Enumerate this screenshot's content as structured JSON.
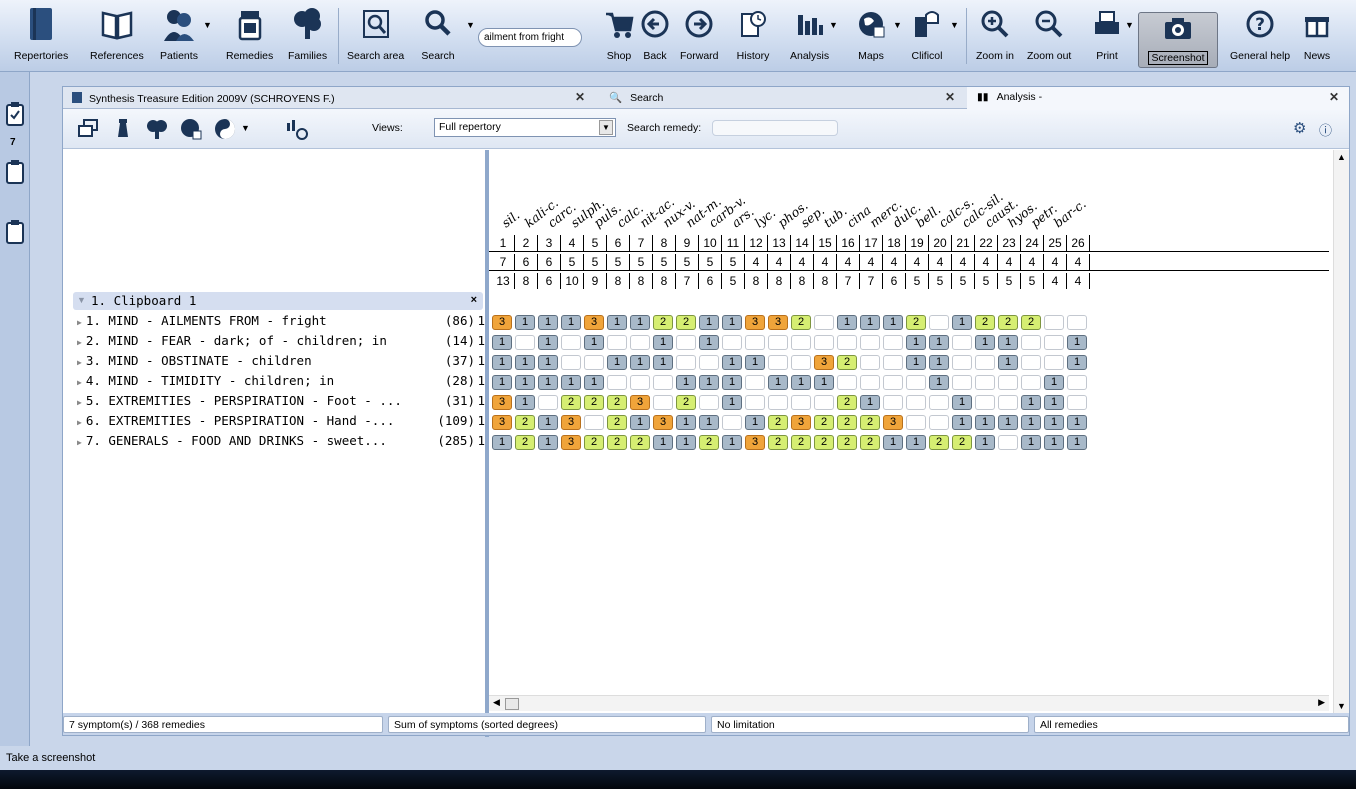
{
  "toolbar": {
    "repertories": "Repertories",
    "references": "References",
    "patients": "Patients",
    "remedies": "Remedies",
    "families": "Families",
    "search_area": "Search area",
    "search": "Search",
    "search_field": "ailment from fright",
    "shop": "Shop",
    "back": "Back",
    "forward": "Forward",
    "history": "History",
    "analysis": "Analysis",
    "maps": "Maps",
    "clificol": "Clificol",
    "zoom_in": "Zoom in",
    "zoom_out": "Zoom out",
    "print": "Print",
    "screenshot": "Screenshot",
    "general_help": "General help",
    "news": "News"
  },
  "left_strip": {
    "clipboard_count": "7"
  },
  "tabs": [
    {
      "label": "Synthesis Treasure Edition 2009V (SCHROYENS F.)"
    },
    {
      "label": "Search"
    },
    {
      "label": "Analysis -"
    }
  ],
  "subbar": {
    "views_label": "Views:",
    "views_value": "Full repertory",
    "search_remedy_label": "Search remedy:"
  },
  "clipboard": {
    "title": "1. Clipboard 1",
    "close": "×"
  },
  "symptoms": [
    {
      "label": "1. MIND - AILMENTS FROM - fright",
      "count": "(86)",
      "weight": "1"
    },
    {
      "label": "2. MIND - FEAR - dark; of - children; in",
      "count": "(14)",
      "weight": "1"
    },
    {
      "label": "3. MIND - OBSTINATE - children",
      "count": "(37)",
      "weight": "1"
    },
    {
      "label": "4. MIND - TIMIDITY - children; in",
      "count": "(28)",
      "weight": "1"
    },
    {
      "label": "5. EXTREMITIES - PERSPIRATION - Foot - ...",
      "count": "(31)",
      "weight": "1"
    },
    {
      "label": "6. EXTREMITIES - PERSPIRATION - Hand -...",
      "count": "(109)",
      "weight": "1"
    },
    {
      "label": "7. GENERALS - FOOD AND DRINKS - sweet...",
      "count": "(285)",
      "weight": "1"
    }
  ],
  "remedies": [
    "sil.",
    "kali-c.",
    "carc.",
    "sulph.",
    "puls.",
    "calc.",
    "nit-ac.",
    "nux-v.",
    "nat-m.",
    "carb-v.",
    "ars.",
    "lyc.",
    "phos.",
    "sep.",
    "tub.",
    "cina",
    "merc.",
    "dulc.",
    "bell.",
    "calc-s.",
    "calc-sil.",
    "caust.",
    "hyos.",
    "petr.",
    "bar-c."
  ],
  "rank": [
    "1",
    "2",
    "3",
    "4",
    "5",
    "6",
    "7",
    "8",
    "9",
    "10",
    "11",
    "12",
    "13",
    "14",
    "15",
    "16",
    "17",
    "18",
    "19",
    "20",
    "21",
    "22",
    "23",
    "24",
    "25",
    "26"
  ],
  "symptom_counts": [
    "7",
    "6",
    "6",
    "5",
    "5",
    "5",
    "5",
    "5",
    "5",
    "5",
    "5",
    "4",
    "4",
    "4",
    "4",
    "4",
    "4",
    "4",
    "4",
    "4",
    "4",
    "4",
    "4",
    "4",
    "4",
    "4"
  ],
  "degree_sums": [
    "13",
    "8",
    "6",
    "10",
    "9",
    "8",
    "8",
    "8",
    "7",
    "6",
    "5",
    "8",
    "8",
    "8",
    "8",
    "7",
    "7",
    "6",
    "5",
    "5",
    "5",
    "5",
    "5",
    "5",
    "4",
    "4"
  ],
  "grades": [
    [
      3,
      1,
      1,
      1,
      3,
      1,
      1,
      2,
      2,
      1,
      1,
      3,
      3,
      2,
      0,
      1,
      1,
      1,
      2,
      0,
      1,
      2,
      2,
      2,
      0,
      0
    ],
    [
      1,
      0,
      1,
      0,
      1,
      0,
      0,
      1,
      0,
      1,
      0,
      0,
      0,
      0,
      0,
      0,
      0,
      0,
      1,
      1,
      0,
      1,
      1,
      0,
      0,
      1
    ],
    [
      1,
      1,
      1,
      0,
      0,
      1,
      1,
      1,
      0,
      0,
      1,
      1,
      0,
      0,
      3,
      2,
      0,
      0,
      1,
      1,
      0,
      0,
      1,
      0,
      0,
      1
    ],
    [
      1,
      1,
      1,
      1,
      1,
      0,
      0,
      0,
      1,
      1,
      1,
      0,
      1,
      1,
      1,
      0,
      0,
      0,
      0,
      1,
      0,
      0,
      0,
      0,
      1,
      0
    ],
    [
      3,
      1,
      0,
      2,
      2,
      2,
      3,
      0,
      2,
      0,
      1,
      0,
      0,
      0,
      0,
      2,
      1,
      0,
      0,
      0,
      1,
      0,
      0,
      1,
      1,
      0
    ],
    [
      3,
      2,
      1,
      3,
      0,
      2,
      1,
      3,
      1,
      1,
      0,
      1,
      2,
      3,
      2,
      2,
      2,
      3,
      0,
      0,
      1,
      1,
      1,
      1,
      1,
      1
    ],
    [
      1,
      2,
      1,
      3,
      2,
      2,
      2,
      1,
      1,
      2,
      1,
      3,
      2,
      2,
      2,
      2,
      2,
      1,
      1,
      2,
      2,
      1,
      0,
      1,
      1,
      1
    ]
  ],
  "status": {
    "symptoms": "7 symptom(s) / 368 remedies",
    "sort": "Sum of symptoms (sorted degrees)",
    "limit": "No limitation",
    "filter": "All remedies"
  },
  "hint": "Take a screenshot"
}
